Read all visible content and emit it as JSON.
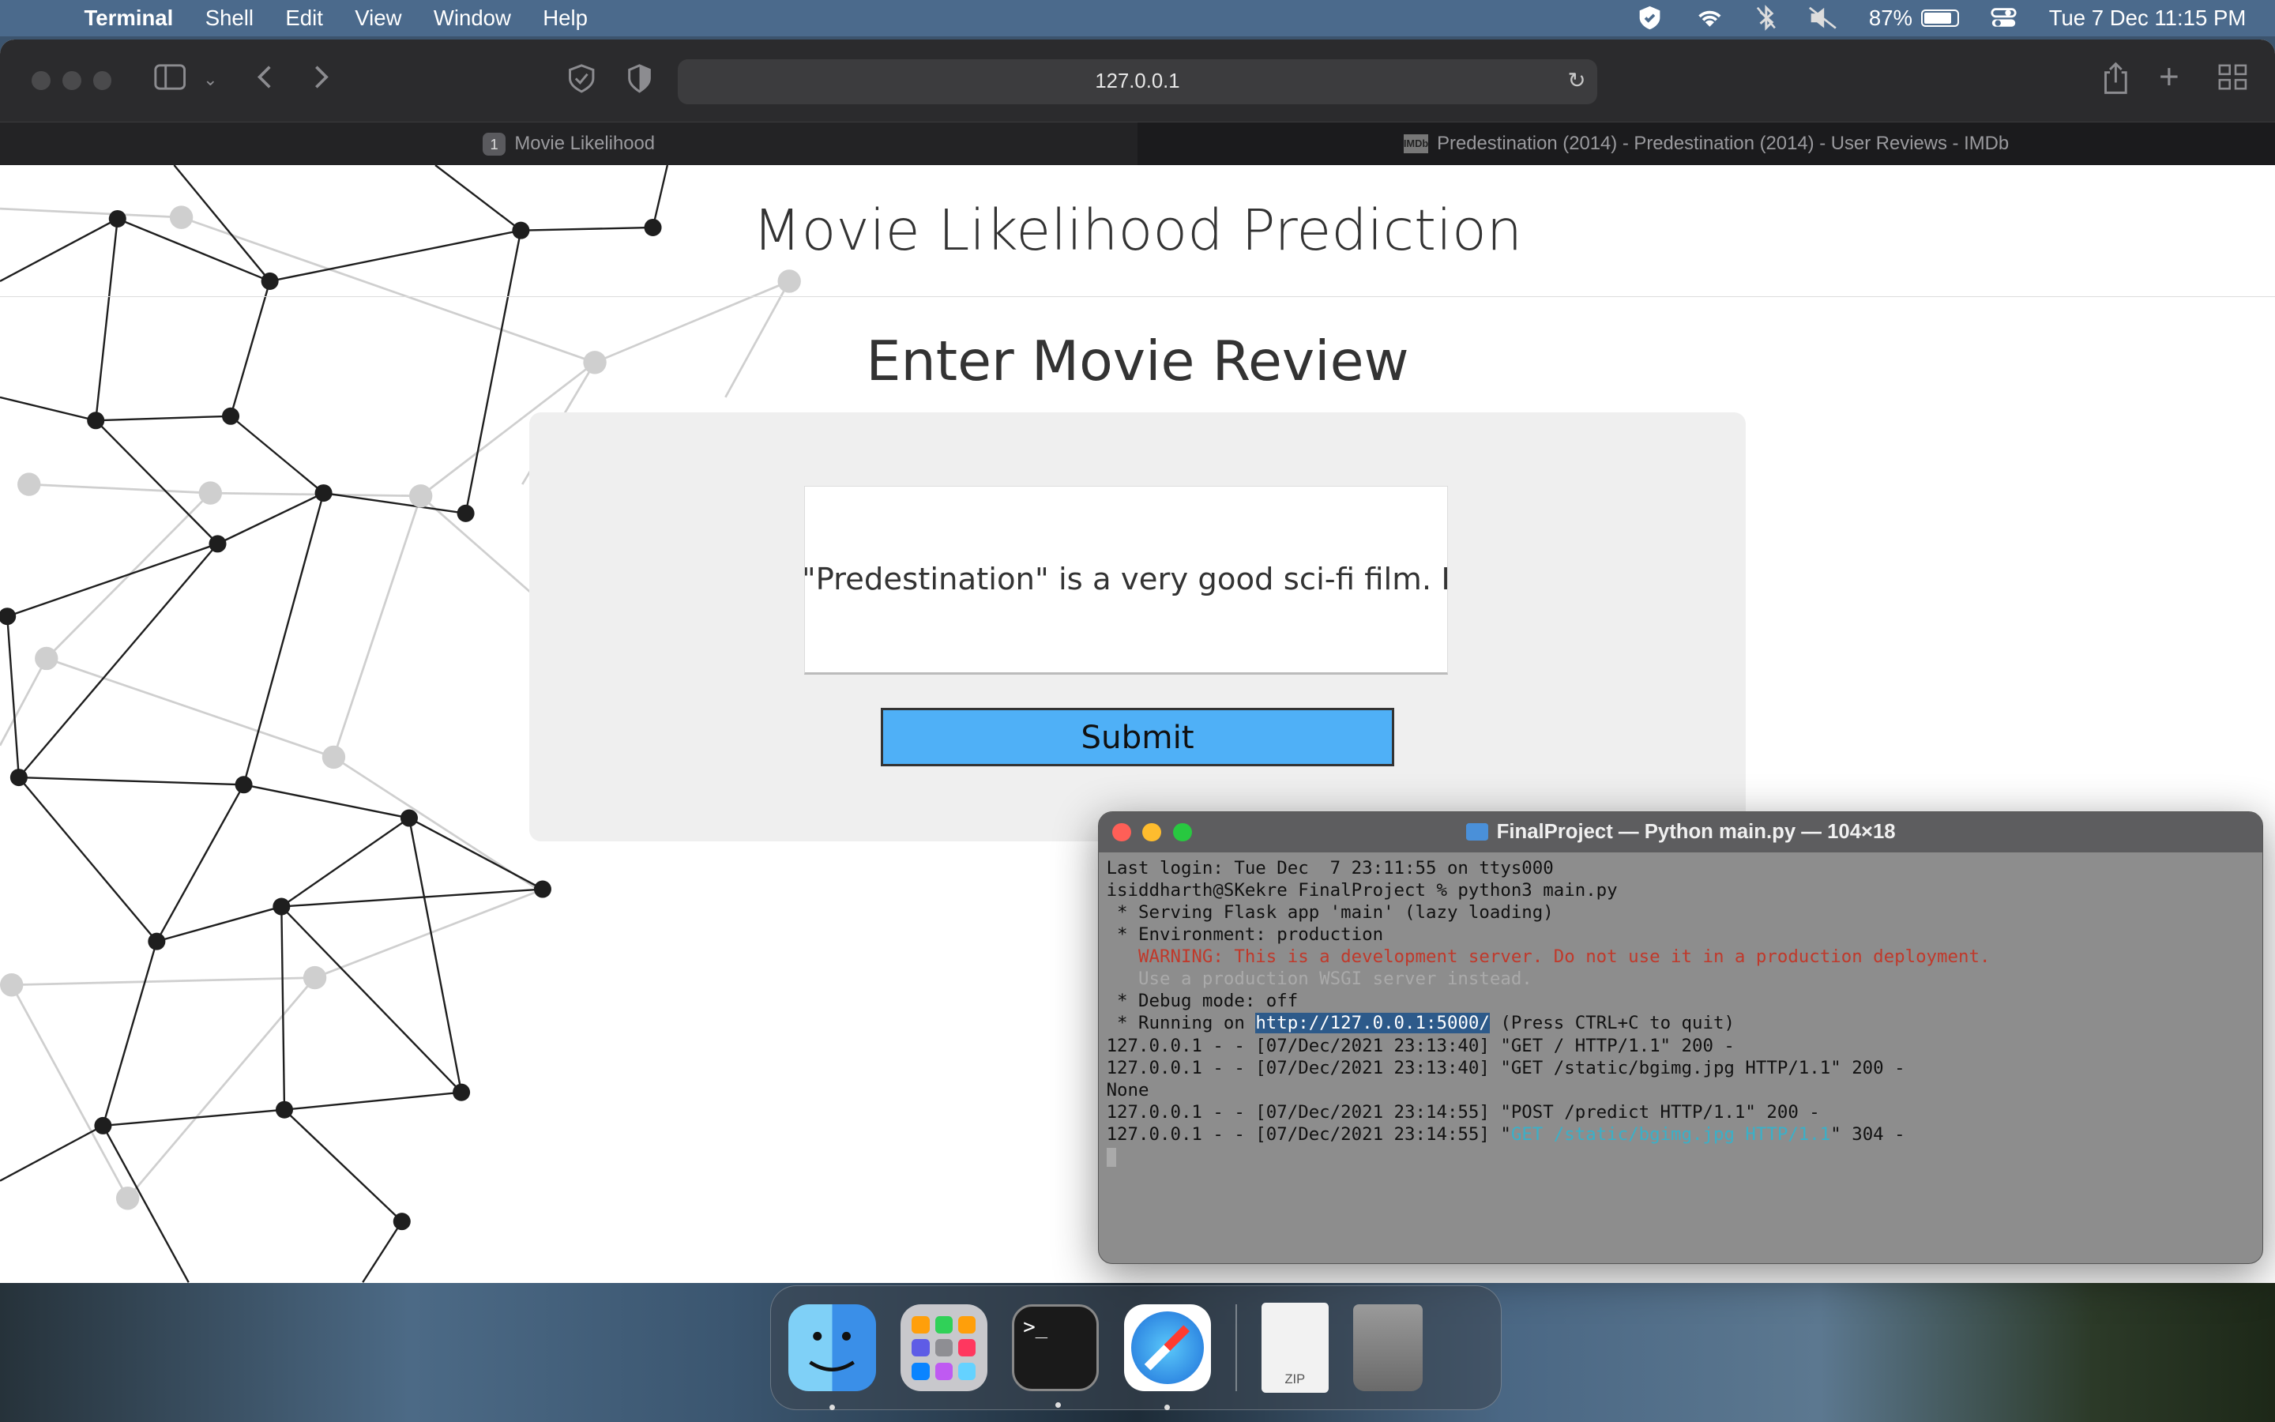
{
  "menubar": {
    "app_name": "Terminal",
    "menus": [
      "Shell",
      "Edit",
      "View",
      "Window",
      "Help"
    ],
    "battery": "87%",
    "datetime": "Tue 7 Dec  11:15 PM"
  },
  "browser": {
    "url": "127.0.0.1",
    "tabs": [
      {
        "number": "1",
        "title": "Movie Likelihood"
      },
      {
        "favicon": "IMDb",
        "title": "Predestination (2014) - Predestination (2014) - User Reviews - IMDb"
      }
    ]
  },
  "page": {
    "title": "Movie Likelihood Prediction",
    "subtitle": "Enter Movie Review",
    "review_text": "\"Predestination\" is a very good sci-fi film. I",
    "submit_label": "Submit"
  },
  "terminal": {
    "title": "FinalProject — Python main.py — 104×18",
    "lines": {
      "l1": "Last login: Tue Dec  7 23:11:55 on ttys000",
      "l2": "isiddharth@SKekre FinalProject % python3 main.py",
      "l3": " * Serving Flask app 'main' (lazy loading)",
      "l4": " * Environment: production",
      "l5": "   WARNING: This is a development server. Do not use it in a production deployment.",
      "l6": "   Use a production WSGI server instead.",
      "l7": " * Debug mode: off",
      "l8_a": " * Running on ",
      "l8_b": "http://127.0.0.1:5000/",
      "l8_c": " (Press CTRL+C to quit)",
      "l9": "127.0.0.1 - - [07/Dec/2021 23:13:40] \"GET / HTTP/1.1\" 200 -",
      "l10": "127.0.0.1 - - [07/Dec/2021 23:13:40] \"GET /static/bgimg.jpg HTTP/1.1\" 200 -",
      "l11": "None",
      "l12": "127.0.0.1 - - [07/Dec/2021 23:14:55] \"POST /predict HTTP/1.1\" 200 -",
      "l13_a": "127.0.0.1 - - [07/Dec/2021 23:14:55] \"",
      "l13_b": "GET /static/bgimg.jpg HTTP/1.1",
      "l13_c": "\" 304 -"
    }
  },
  "dock": {
    "items": [
      "finder-icon",
      "launchpad-icon",
      "terminal-icon",
      "safari-icon",
      "zip-file-icon",
      "trash-icon"
    ],
    "terminal_prompt": ">_",
    "zip_label": "ZIP"
  }
}
